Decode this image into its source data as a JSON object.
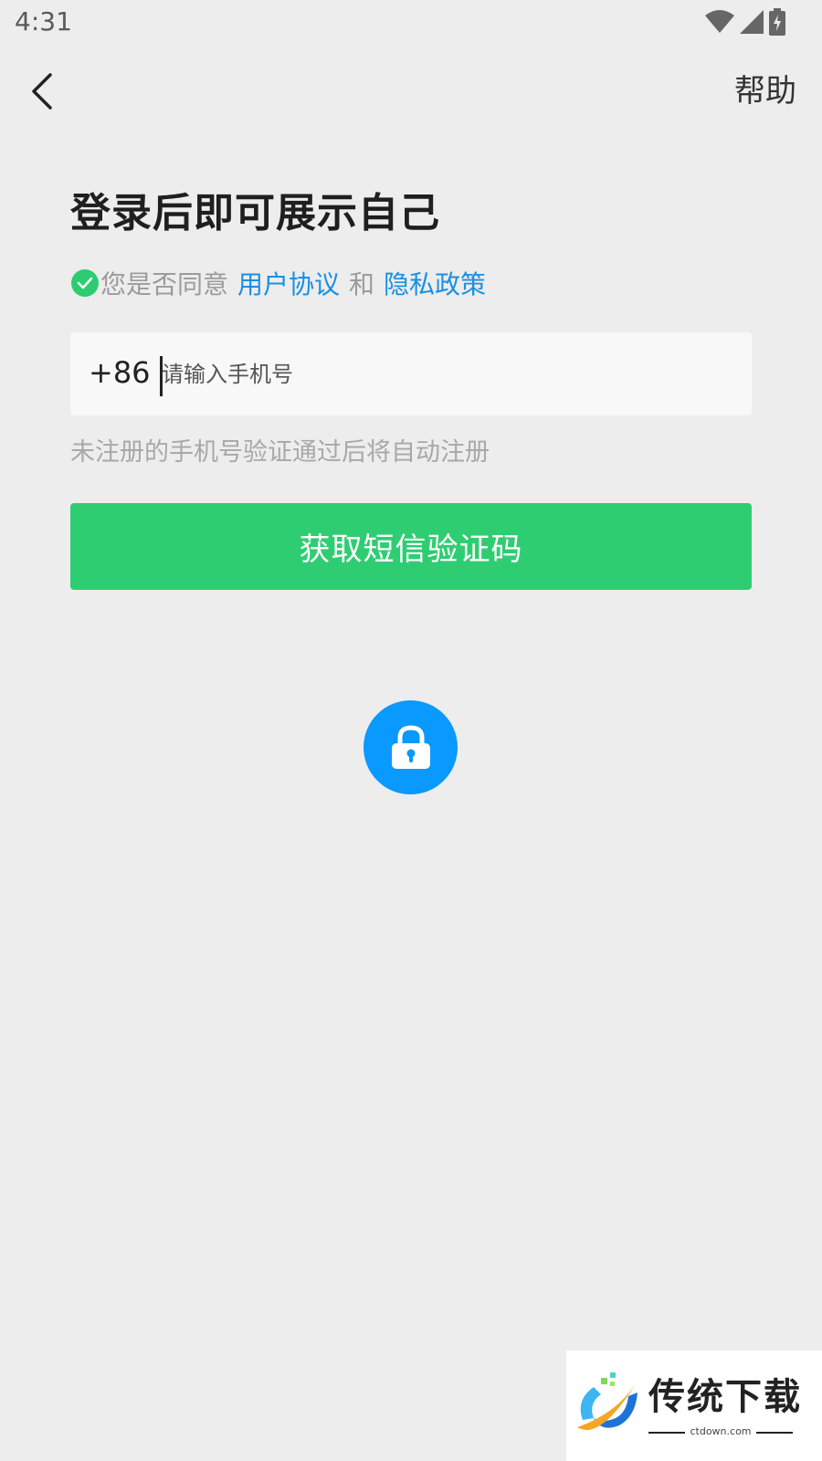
{
  "status_bar": {
    "time": "4:31"
  },
  "nav": {
    "help_label": "帮助"
  },
  "login": {
    "title": "登录后即可展示自己",
    "agreement_prefix": "您是否同意",
    "user_agreement": "用户协议",
    "conjunction": "和",
    "privacy_policy": "隐私政策",
    "country_code": "+86",
    "phone_value": "",
    "phone_placeholder": "请输入手机号",
    "hint": "未注册的手机号验证通过后将自动注册",
    "sms_button": "获取短信验证码"
  },
  "watermark": {
    "brand": "传统下载",
    "domain": "ctdown.com"
  },
  "colors": {
    "background": "#ededed",
    "primary_green": "#2fcd72",
    "link_blue": "#1a8fe3",
    "lock_blue": "#0a99ff"
  }
}
